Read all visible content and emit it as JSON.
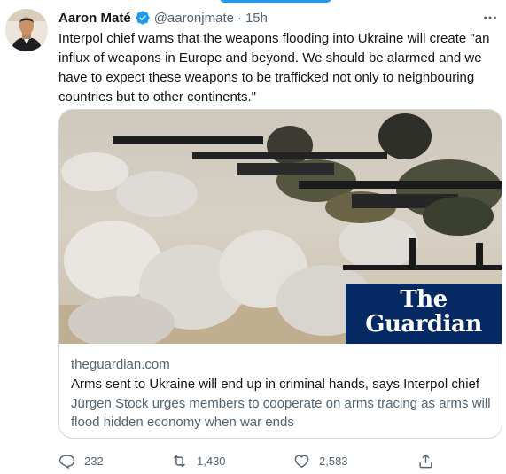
{
  "tweet": {
    "author_name": "Aaron Maté",
    "handle": "@aaronjmate",
    "separator": "·",
    "time": "15h",
    "text": "Interpol chief warns that the weapons flooding into Ukraine will create \"an influx of weapons in Europe and beyond.  We should be alarmed and we have to expect these weapons to be trafficked not only to neighbouring countries but to other continents.\""
  },
  "card": {
    "logo_line1": "The",
    "logo_line2": "Guardian",
    "domain": "theguardian.com",
    "title": "Arms sent to Ukraine will end up in criminal hands, says Interpol chief",
    "description": "Jürgen Stock urges members to cooperate on arms tracing as arms will flood hidden economy when war ends"
  },
  "actions": {
    "replies": "232",
    "retweets": "1,430",
    "likes": "2,583"
  },
  "colors": {
    "verified": "#1d9bf0",
    "guardian_blue": "#052962",
    "secondary_text": "#536471",
    "border": "#cfd9de"
  },
  "icons": [
    "verified-badge-icon",
    "more-icon",
    "reply-icon",
    "retweet-icon",
    "like-icon",
    "share-icon"
  ]
}
